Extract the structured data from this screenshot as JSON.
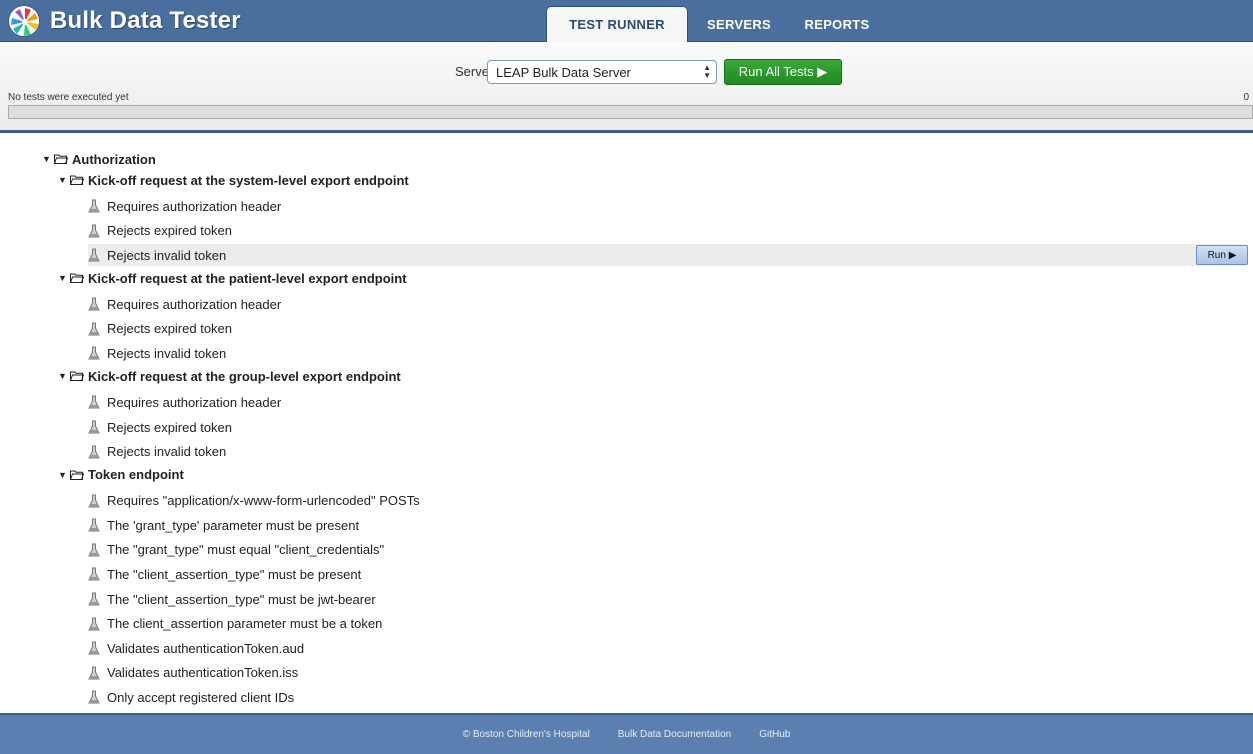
{
  "app": {
    "title": "Bulk Data Tester"
  },
  "tabs": [
    {
      "label": "TEST RUNNER",
      "active": true
    },
    {
      "label": "SERVERS",
      "active": false
    },
    {
      "label": "REPORTS",
      "active": false
    }
  ],
  "controls": {
    "server_label": "Server:",
    "server_selected": "LEAP Bulk Data Server",
    "run_all_label": "Run All Tests ▶",
    "status_text": "No tests were executed yet",
    "status_count": "0",
    "progress_fraction": 0
  },
  "tree": {
    "root": "Authorization",
    "groups": [
      {
        "label": "Kick-off request at the system-level export endpoint",
        "tests": [
          "Requires authorization header",
          "Rejects expired token",
          "Rejects invalid token"
        ]
      },
      {
        "label": "Kick-off request at the patient-level export endpoint",
        "tests": [
          "Requires authorization header",
          "Rejects expired token",
          "Rejects invalid token"
        ]
      },
      {
        "label": "Kick-off request at the group-level export endpoint",
        "tests": [
          "Requires authorization header",
          "Rejects expired token",
          "Rejects invalid token"
        ]
      },
      {
        "label": "Token endpoint",
        "tests": [
          "Requires \"application/x-www-form-urlencoded\" POSTs",
          "The 'grant_type' parameter must be present",
          "The \"grant_type\" must equal \"client_credentials\"",
          "The \"client_assertion_type\" must be present",
          "The \"client_assertion_type\" must be jwt-bearer",
          "The client_assertion parameter must be a token",
          "Validates authenticationToken.aud",
          "Validates authenticationToken.iss",
          "Only accept registered client IDs"
        ]
      }
    ],
    "run_label": "Run ▶"
  },
  "footer": {
    "copyright": "© Boston Children's Hospital",
    "docs_link": "Bulk Data Documentation",
    "github_link": "GitHub"
  }
}
